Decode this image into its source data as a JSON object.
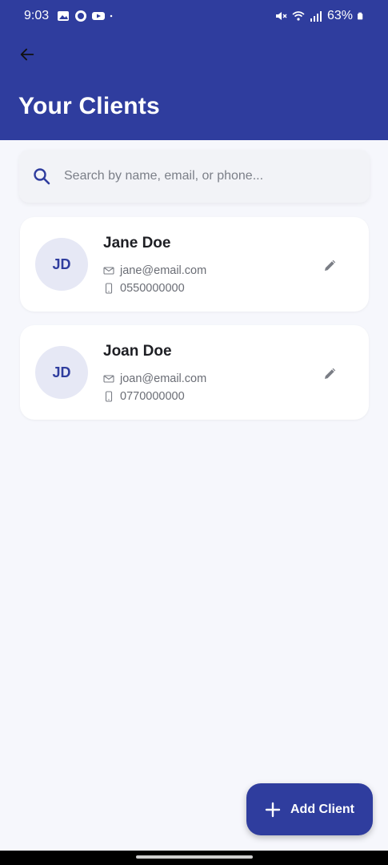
{
  "status_bar": {
    "time": "9:03",
    "battery": "63%",
    "icons_left": [
      "gallery-icon",
      "whatsapp-icon",
      "youtube-icon",
      "dot-icon"
    ],
    "icons_right": [
      "mute-icon",
      "wifi-icon",
      "signal-icon",
      "battery-icon"
    ]
  },
  "header": {
    "title": "Your Clients",
    "back_icon": "arrow-left-icon"
  },
  "search": {
    "placeholder": "Search by name, email, or phone...",
    "value": ""
  },
  "clients": [
    {
      "initials": "JD",
      "name": "Jane Doe",
      "email": "jane@email.com",
      "phone": "0550000000"
    },
    {
      "initials": "JD",
      "name": "Joan Doe",
      "email": "joan@email.com",
      "phone": "0770000000"
    }
  ],
  "fab": {
    "label": "Add Client",
    "icon": "plus-icon"
  },
  "colors": {
    "primary": "#2f3d9e",
    "background": "#f6f7fc",
    "card": "#ffffff",
    "avatar_bg": "#e6e8f5"
  }
}
